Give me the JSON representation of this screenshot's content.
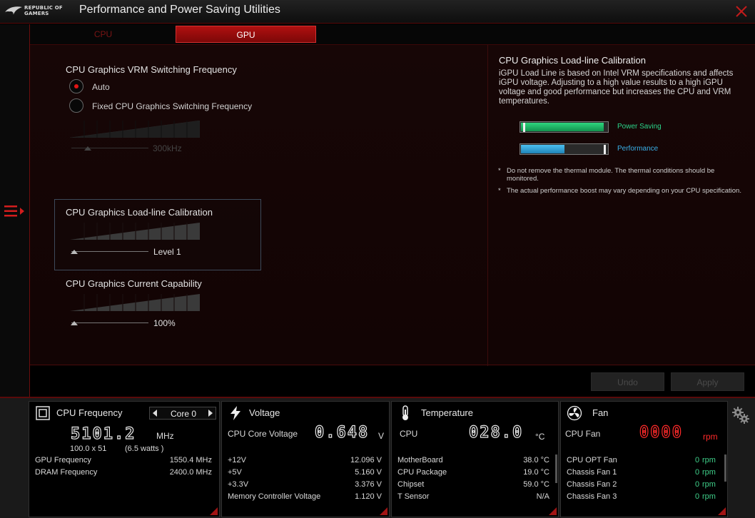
{
  "app": {
    "logo_line1": "REPUBLIC OF",
    "logo_line2": "GAMERS",
    "title": "Performance and Power Saving Utilities"
  },
  "tabs": [
    {
      "label": "CPU",
      "active": false
    },
    {
      "label": "GPU",
      "active": true
    }
  ],
  "vrm": {
    "title": "CPU Graphics VRM Switching Frequency",
    "options": [
      {
        "label": "Auto",
        "selected": true
      },
      {
        "label": "Fixed CPU Graphics Switching Frequency",
        "selected": false
      }
    ],
    "value": "300kHz"
  },
  "llc": {
    "title": "CPU Graphics Load-line Calibration",
    "value": "Level 1"
  },
  "current": {
    "title": "CPU Graphics Current Capability",
    "value": "100%"
  },
  "help": {
    "title": "CPU Graphics Load-line Calibration",
    "text": "iGPU Load Line is based on Intel VRM specifications and affects iGPU voltage. Adjusting to a high value results to a high iGPU voltage and good performance but increases the CPU and VRM temperatures.",
    "bars": [
      {
        "label": "Power Saving",
        "color": "#1db86a",
        "fill": 0.96
      },
      {
        "label": "Performance",
        "color": "#2a9fd6",
        "fill": 0.5
      }
    ],
    "notes": [
      "Do not remove the thermal module. The thermal conditions should be monitored.",
      "The actual performance boost may vary depending on your CPU specification."
    ],
    "note_star": "*"
  },
  "actions": {
    "undo": "Undo",
    "apply": "Apply"
  },
  "monitor": {
    "cpu": {
      "title": "CPU Frequency",
      "core": "Core 0",
      "freq": "5101.2",
      "freq_unit": "MHz",
      "ratio_left": "100.0  x  51",
      "ratio_watts": "(6.5     watts )",
      "rows": [
        {
          "label": "GPU Frequency",
          "value": "1550.4  MHz"
        },
        {
          "label": "DRAM Frequency",
          "value": "2400.0  MHz"
        }
      ]
    },
    "voltage": {
      "title": "Voltage",
      "main_label": "CPU Core Voltage",
      "main_value": "0.648",
      "main_unit": "V",
      "rows": [
        {
          "label": "+12V",
          "value": "12.096  V"
        },
        {
          "label": "+5V",
          "value": "5.160  V"
        },
        {
          "label": "+3.3V",
          "value": "3.376  V"
        },
        {
          "label": "Memory Controller Voltage",
          "value": "1.120  V"
        }
      ]
    },
    "temperature": {
      "title": "Temperature",
      "main_label": "CPU",
      "main_value": "028.0",
      "main_unit": "°C",
      "rows": [
        {
          "label": "MotherBoard",
          "value": "38.0 °C"
        },
        {
          "label": "CPU Package",
          "value": "19.0 °C"
        },
        {
          "label": "Chipset",
          "value": "59.0 °C"
        },
        {
          "label": "T Sensor",
          "value": "N/A"
        }
      ]
    },
    "fan": {
      "title": "Fan",
      "main_label": "CPU Fan",
      "main_value": "0000",
      "main_unit": "rpm",
      "rows": [
        {
          "label": "CPU OPT Fan",
          "value": "0",
          "unit": "rpm"
        },
        {
          "label": "Chassis Fan 1",
          "value": "0",
          "unit": "rpm"
        },
        {
          "label": "Chassis Fan 2",
          "value": "0",
          "unit": "rpm"
        },
        {
          "label": "Chassis Fan 3",
          "value": "0",
          "unit": "rpm"
        }
      ]
    }
  }
}
